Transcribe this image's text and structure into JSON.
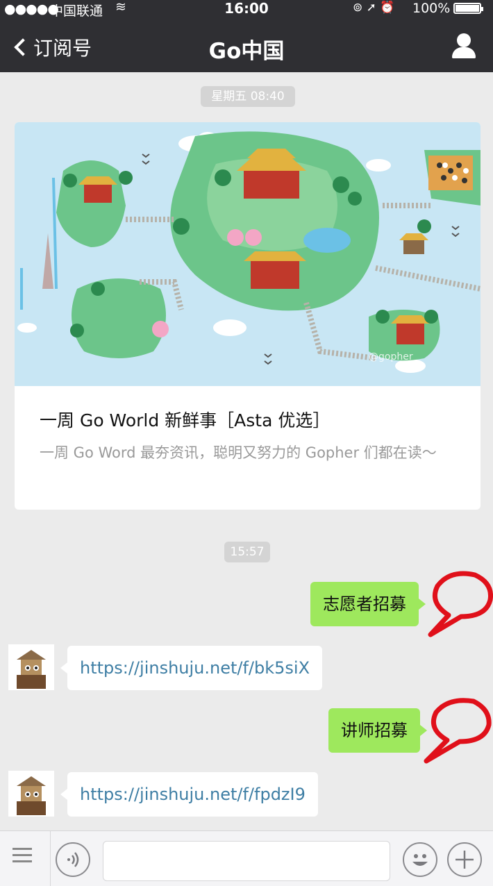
{
  "status_bar": {
    "signal": "●●●●●",
    "carrier": "中国联通",
    "time": "16:00",
    "battery": "100%"
  },
  "nav": {
    "back_label": "订阅号",
    "title": "Go中国"
  },
  "messages": {
    "stamp1": "星期五 08:40",
    "article": {
      "title": "一周 Go World 新鲜事［Asta 优选］",
      "desc": "一周 Go Word 最夯资讯，聪明又努力的 Gopher 们都在读～"
    },
    "stamp2": "15:57",
    "sent1": "志愿者招募",
    "recv1": "https://jinshuju.net/f/bk5siX",
    "sent2": "讲师招募",
    "recv2": "https://jinshuju.net/f/fpdzI9"
  },
  "colors": {
    "header_bg": "#2f2f33",
    "sent_bubble": "#9ee85d",
    "link": "#3e7ea4",
    "annotation_red": "#e0101a"
  }
}
